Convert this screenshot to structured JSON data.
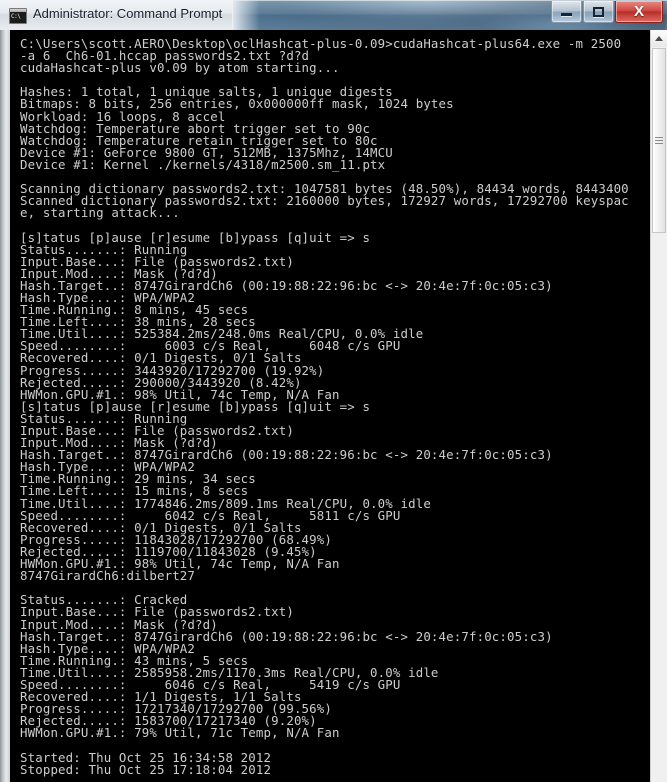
{
  "window": {
    "title": "Administrator: Command Prompt",
    "icon": "command-prompt-icon",
    "icon_glyph": "C:\\",
    "buttons": {
      "minimize": "minimize-button",
      "maximize": "maximize-button",
      "close_label": "X"
    }
  },
  "scrollbar": {
    "up_arrow": "scroll-up-arrow",
    "thumb": "scroll-thumb"
  },
  "console": {
    "prompt_path": "C:\\Users\\scott.AERO\\Desktop\\oclHashcat-plus-0.09>",
    "command": "cudaHashcat-plus64.exe -m 2500 -a 6  Ch6-01.hccap passwords2.txt ?d?d",
    "banner": "cudaHashcat-plus v0.09 by atom starting...",
    "cracked_hash": "8747GirardCh6:dilbert27",
    "started": "Started: Thu Oct 25 16:34:58 2012",
    "stopped": "Stopped: Thu Oct 25 17:18:04 2012",
    "menu_line": "[s]tatus [p]ause [r]esume [b]ypass [q]uit => s",
    "text": "C:\\Users\\scott.AERO\\Desktop\\oclHashcat-plus-0.09>cudaHashcat-plus64.exe -m 2500\n-a 6  Ch6-01.hccap passwords2.txt ?d?d\ncudaHashcat-plus v0.09 by atom starting...\n\nHashes: 1 total, 1 unique salts, 1 unique digests\nBitmaps: 8 bits, 256 entries, 0x000000ff mask, 1024 bytes\nWorkload: 16 loops, 8 accel\nWatchdog: Temperature abort trigger set to 90c\nWatchdog: Temperature retain trigger set to 80c\nDevice #1: GeForce 9800 GT, 512MB, 1375Mhz, 14MCU\nDevice #1: Kernel ./kernels/4318/m2500.sm_11.ptx\n\nScanning dictionary passwords2.txt: 1047581 bytes (48.50%), 84434 words, 8443400\nScanned dictionary passwords2.txt: 2160000 bytes, 172927 words, 17292700 keyspac\ne, starting attack...\n\n[s]tatus [p]ause [r]esume [b]ypass [q]uit => s\nStatus.......: Running\nInput.Base...: File (passwords2.txt)\nInput.Mod....: Mask (?d?d)\nHash.Target..: 8747GirardCh6 (00:19:88:22:96:bc <-> 20:4e:7f:0c:05:c3)\nHash.Type....: WPA/WPA2\nTime.Running.: 8 mins, 45 secs\nTime.Left....: 38 mins, 28 secs\nTime.Util....: 525384.2ms/248.0ms Real/CPU, 0.0% idle\nSpeed........:     6003 c/s Real,     6048 c/s GPU\nRecovered....: 0/1 Digests, 0/1 Salts\nProgress.....: 3443920/17292700 (19.92%)\nRejected.....: 290000/3443920 (8.42%)\nHWMon.GPU.#1.: 98% Util, 74c Temp, N/A Fan\n[s]tatus [p]ause [r]esume [b]ypass [q]uit => s\nStatus.......: Running\nInput.Base...: File (passwords2.txt)\nInput.Mod....: Mask (?d?d)\nHash.Target..: 8747GirardCh6 (00:19:88:22:96:bc <-> 20:4e:7f:0c:05:c3)\nHash.Type....: WPA/WPA2\nTime.Running.: 29 mins, 34 secs\nTime.Left....: 15 mins, 8 secs\nTime.Util....: 1774846.2ms/809.1ms Real/CPU, 0.0% idle\nSpeed........:     6042 c/s Real,     5811 c/s GPU\nRecovered....: 0/1 Digests, 0/1 Salts\nProgress.....: 11843028/17292700 (68.49%)\nRejected.....: 1119700/11843028 (9.45%)\nHWMon.GPU.#1.: 98% Util, 74c Temp, N/A Fan\n8747GirardCh6:dilbert27\n\nStatus.......: Cracked\nInput.Base...: File (passwords2.txt)\nInput.Mod....: Mask (?d?d)\nHash.Target..: 8747GirardCh6 (00:19:88:22:96:bc <-> 20:4e:7f:0c:05:c3)\nHash.Type....: WPA/WPA2\nTime.Running.: 43 mins, 5 secs\nTime.Util....: 2585958.2ms/1170.3ms Real/CPU, 0.0% idle\nSpeed........:     6046 c/s Real,     5419 c/s GPU\nRecovered....: 1/1 Digests, 1/1 Salts\nProgress.....: 17217340/17292700 (99.56%)\nRejected.....: 1583700/17217340 (9.20%)\nHWMon.GPU.#1.: 79% Util, 71c Temp, N/A Fan\n\nStarted: Thu Oct 25 16:34:58 2012\nStopped: Thu Oct 25 17:18:04 2012"
  },
  "colors": {
    "console_bg": "#000000",
    "console_fg": "#cdcdcd",
    "frame": "#d4d8db",
    "close_button": "#b62f28"
  }
}
